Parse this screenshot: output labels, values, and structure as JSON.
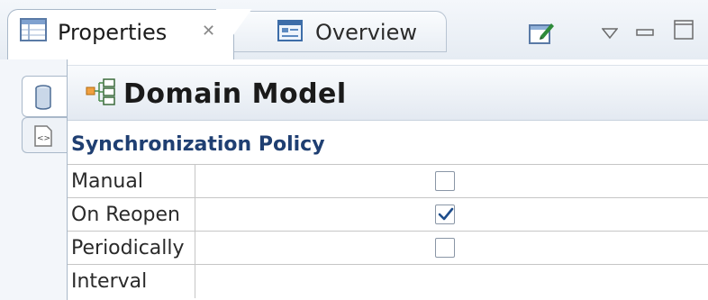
{
  "tabs": {
    "active": {
      "label": "Properties",
      "close_icon": "close-x-icon",
      "icon": "properties-table-icon"
    },
    "inactive": {
      "label": "Overview",
      "icon": "overview-form-icon"
    }
  },
  "toolbar": {
    "icons": [
      "pin-editor-icon",
      "view-menu-triangle-icon",
      "minimize-icon",
      "maximize-icon"
    ]
  },
  "side_tabs": [
    {
      "icon": "database-cylinder-icon",
      "active": true
    },
    {
      "icon": "xml-file-icon",
      "active": false
    }
  ],
  "model": {
    "icon": "domain-model-tree-icon",
    "title": "Domain Model"
  },
  "sync_policy": {
    "section_title": "Synchronization Policy",
    "rows": [
      {
        "label": "Manual",
        "checked": false
      },
      {
        "label": "On Reopen",
        "checked": true
      },
      {
        "label": "Periodically",
        "checked": false
      },
      {
        "label": "Interval",
        "value": ""
      }
    ]
  },
  "colors": {
    "section_title": "#1f3f72",
    "checkmark": "#1f4e8c",
    "border": "#a9b8c9"
  }
}
